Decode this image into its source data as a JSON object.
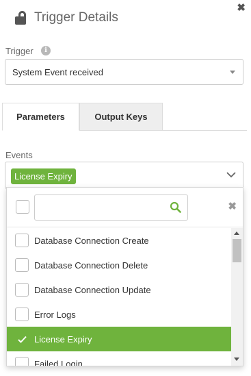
{
  "header": {
    "title": "Trigger Details"
  },
  "trigger": {
    "label": "Trigger",
    "selected_value": "System Event received"
  },
  "tabs": [
    {
      "label": "Parameters",
      "active": true
    },
    {
      "label": "Output Keys",
      "active": false
    }
  ],
  "events": {
    "label": "Events",
    "selected_tags": [
      "License Expiry"
    ],
    "search_placeholder": "",
    "options": [
      {
        "label": "Database Connection Create",
        "checked": false
      },
      {
        "label": "Database Connection Delete",
        "checked": false
      },
      {
        "label": "Database Connection Update",
        "checked": false
      },
      {
        "label": "Error Logs",
        "checked": false
      },
      {
        "label": "License Expiry",
        "checked": true
      },
      {
        "label": "Failed Login",
        "checked": false
      }
    ]
  },
  "icons": {
    "close": "close-icon",
    "lock": "unlock-icon",
    "info": "info-icon",
    "search": "search-icon",
    "clear": "clear-icon",
    "chevron": "chevron-down-icon"
  },
  "colors": {
    "accent": "#6fb33d",
    "tab_inactive_bg": "#eeeeee",
    "border": "#cccccc"
  }
}
